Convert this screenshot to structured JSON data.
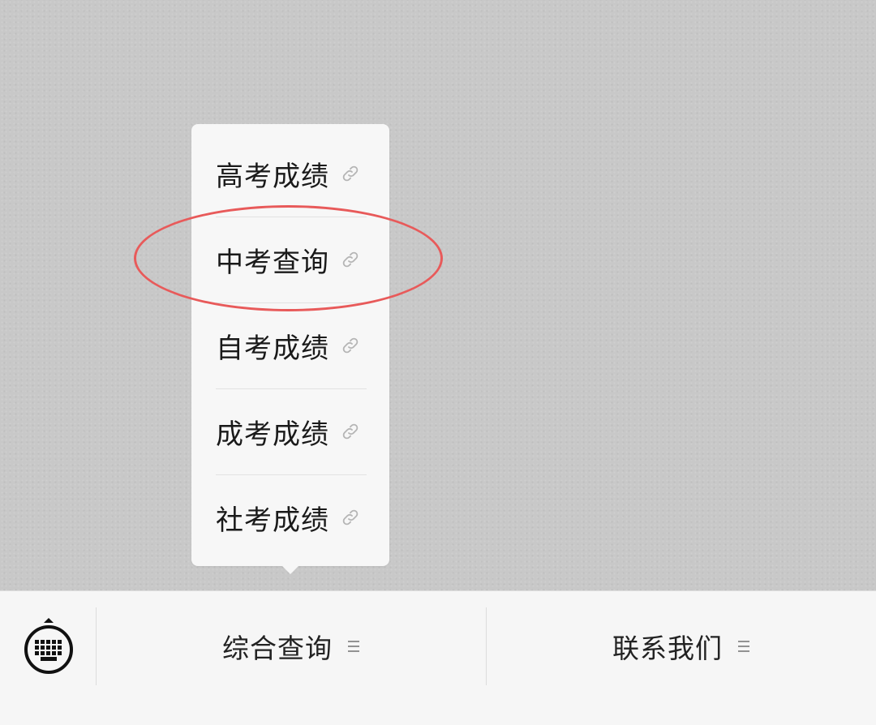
{
  "submenu": {
    "items": [
      {
        "label": "高考成绩",
        "icon": "link-icon"
      },
      {
        "label": "中考查询",
        "icon": "link-icon"
      },
      {
        "label": "自考成绩",
        "icon": "link-icon"
      },
      {
        "label": "成考成绩",
        "icon": "link-icon"
      },
      {
        "label": "社考成绩",
        "icon": "link-icon"
      }
    ],
    "highlighted_index": 1,
    "highlight_color": "#e85a5a"
  },
  "menu_bar": {
    "keyboard_icon": "keyboard-icon",
    "tabs": [
      {
        "label": "综合查询",
        "icon": "menu-lines-icon"
      },
      {
        "label": "联系我们",
        "icon": "menu-lines-icon"
      }
    ]
  }
}
